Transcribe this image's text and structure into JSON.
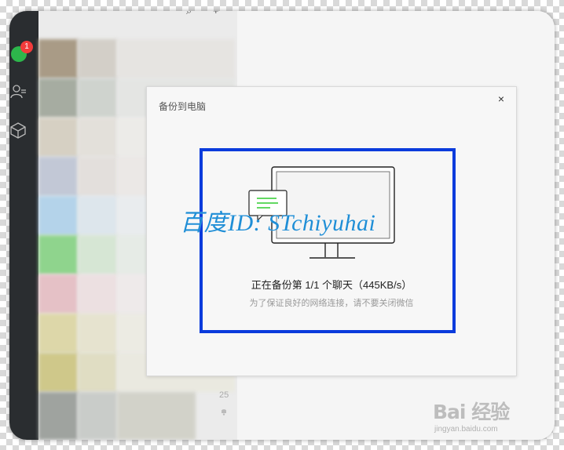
{
  "sidebar": {
    "badge_count": "1",
    "icons": [
      "contacts-icon",
      "box-icon"
    ]
  },
  "chat_list": {
    "item_time": "25"
  },
  "dialog": {
    "title": "备份到电脑",
    "close_label": "×",
    "status_main": "正在备份第 1/1 个聊天（445KB/s）",
    "status_sub": "为了保证良好的网络连接，请不要关闭微信",
    "highlight_color": "#0a3bdc"
  },
  "watermark": {
    "text": "百度ID: STchiyuhai",
    "color": "#1f8ed6"
  },
  "baidu_brand": {
    "logo_text": "Bai 经验",
    "url": "jingyan.baidu.com"
  },
  "colors": {
    "sidebar_bg": "#2a2d30",
    "badge": "#f33b3b",
    "avatar": "#2db64b",
    "screen_accent": "#2ecc2e"
  }
}
